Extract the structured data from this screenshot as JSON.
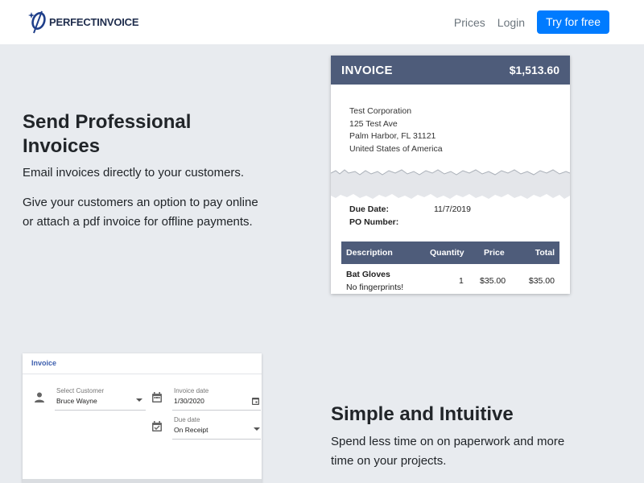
{
  "header": {
    "logo_part1": "PERFECT",
    "logo_part2": "INVOICE",
    "nav": {
      "prices": "Prices",
      "login": "Login"
    },
    "cta": "Try for free"
  },
  "section1": {
    "title": "Send Professional Invoices",
    "p1": "Email invoices directly to your customers.",
    "p2": "Give your customers an option to pay online or attach a pdf invoice for offline payments."
  },
  "invoice_preview": {
    "title": "INVOICE",
    "amount": "$1,513.60",
    "address": [
      "Test Corporation",
      "125 Test Ave",
      "Palm Harbor, FL 31121",
      "United States of America"
    ],
    "due_date_label": "Due Date:",
    "due_date": "11/7/2019",
    "po_label": "PO Number:",
    "columns": {
      "description": "Description",
      "quantity": "Quantity",
      "price": "Price",
      "total": "Total"
    },
    "rows": [
      {
        "name": "Bat Gloves",
        "note": "No fingerprints!",
        "quantity": "1",
        "price": "$35.00",
        "total": "$35.00"
      }
    ]
  },
  "form_preview": {
    "title": "Invoice",
    "customer_label": "Select Customer",
    "customer_value": "Bruce Wayne",
    "invoice_date_label": "Invoice date",
    "invoice_date_value": "1/30/2020",
    "due_date_label": "Due date",
    "due_date_value": "On Receipt"
  },
  "section2": {
    "title": "Simple and Intuitive",
    "p": "Spend less time on on paperwork and more time on your projects."
  },
  "colors": {
    "accent": "#007bff",
    "invoice_header": "#4e5c7a",
    "page_bg": "#e8ebef"
  },
  "icons": [
    "logo-icon",
    "person-icon",
    "calendar-icon",
    "calendar-check-icon"
  ]
}
